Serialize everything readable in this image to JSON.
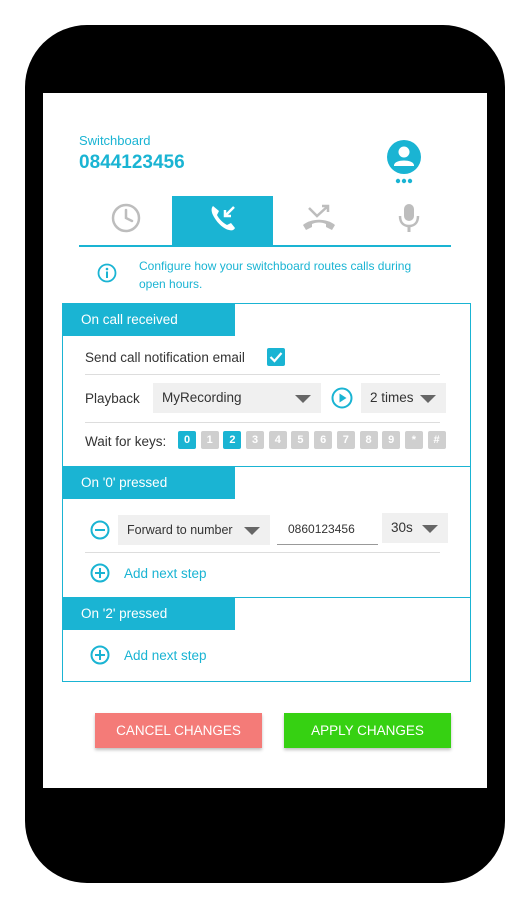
{
  "account": {
    "label": "Switchboard",
    "number": "0844123456"
  },
  "tabs": [
    {
      "name": "open-hours",
      "icon": "clock-icon",
      "active": false
    },
    {
      "name": "incoming-call",
      "icon": "phone-incoming-icon",
      "active": true
    },
    {
      "name": "missed-call",
      "icon": "phone-missed-icon",
      "active": false
    },
    {
      "name": "voicemail",
      "icon": "microphone-icon",
      "active": false
    }
  ],
  "info": {
    "text_line1": "Configure how your switchboard routes calls during",
    "text_line2": "open hours."
  },
  "call_received": {
    "header": "On call received",
    "notification_label": "Send call notification email",
    "notification_checked": true,
    "playback_label": "Playback",
    "playback_value": "MyRecording",
    "repeat_value": "2 times",
    "wait_label": "Wait for keys:",
    "keys": [
      {
        "label": "0",
        "on": true
      },
      {
        "label": "1",
        "on": false
      },
      {
        "label": "2",
        "on": true
      },
      {
        "label": "3",
        "on": false
      },
      {
        "label": "4",
        "on": false
      },
      {
        "label": "5",
        "on": false
      },
      {
        "label": "6",
        "on": false
      },
      {
        "label": "7",
        "on": false
      },
      {
        "label": "8",
        "on": false
      },
      {
        "label": "9",
        "on": false
      },
      {
        "label": "*",
        "on": false
      },
      {
        "label": "#",
        "on": false
      }
    ]
  },
  "pressed_0": {
    "header": "On '0' pressed",
    "action_value": "Forward to number",
    "number_value": "0860123456",
    "timeout_value": "30s",
    "add_step": "Add next step"
  },
  "pressed_2": {
    "header": "On '2' pressed",
    "add_step": "Add next step"
  },
  "buttons": {
    "cancel": "CANCEL CHANGES",
    "apply": "APPLY CHANGES"
  },
  "colors": {
    "accent": "#1ab4d3",
    "cancel": "#f47b78",
    "apply": "#36d112",
    "inactive_icon": "#bdbdbd"
  }
}
